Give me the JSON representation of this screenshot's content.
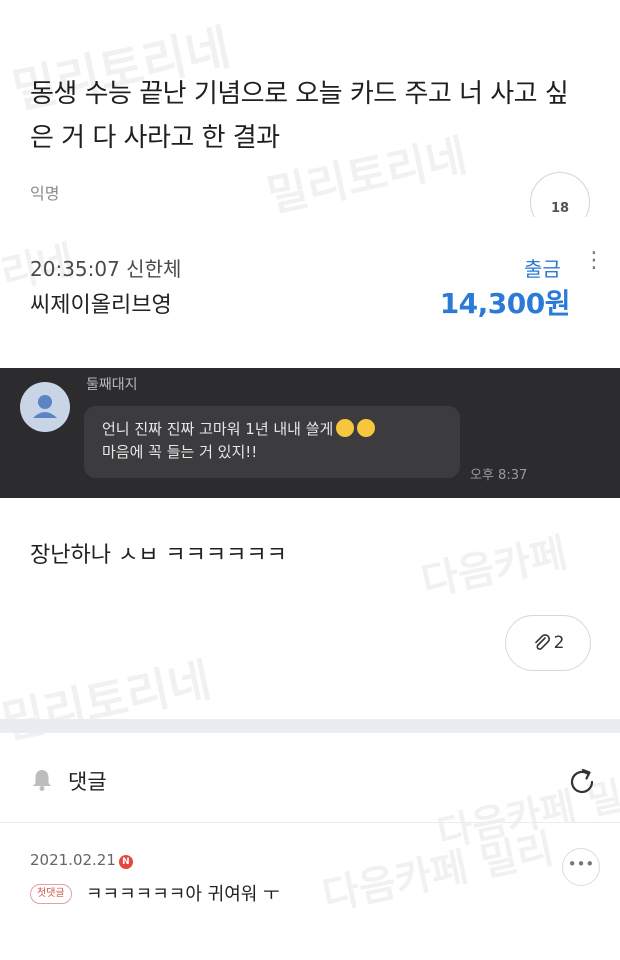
{
  "watermarks": [
    "밀리토리네",
    "밀리토리네",
    "리네",
    "다음카페 밀리토리네",
    "다음카페",
    "밀리토리네",
    "다음카페 밀리",
    "다음카페 밀리"
  ],
  "post": {
    "title": "동생 수능 끝난 기념으로 오늘 카드 주고 너 사고 싶은 거 다 사라고 한 결과",
    "author": "익명",
    "like_count": "18"
  },
  "bank_notification": {
    "time_bank": "20:35:07 신한체",
    "merchant": "씨제이올리브영",
    "type": "출금",
    "more_icon": "kebab-menu-icon",
    "amount": "14,300원"
  },
  "chat": {
    "sender": "둘째대지",
    "message_line1": "언니 진짜 진짜 고마워 1년 내내 쓸게",
    "message_line2": "마음에 꼭 들는 거 있지!!",
    "time": "오후 8:37"
  },
  "body_text": "장난하나 ㅅㅂ ㅋㅋㅋㅋㅋㅋ",
  "attachment": {
    "icon": "paperclip-icon",
    "count": "2"
  },
  "comments": {
    "label": "댓글",
    "items": [
      {
        "date": "2021.02.21",
        "new_badge": "N",
        "badge": "첫댓글",
        "text": "ㅋㅋㅋㅋㅋㅋ아 귀여워 ㅜ"
      }
    ]
  }
}
